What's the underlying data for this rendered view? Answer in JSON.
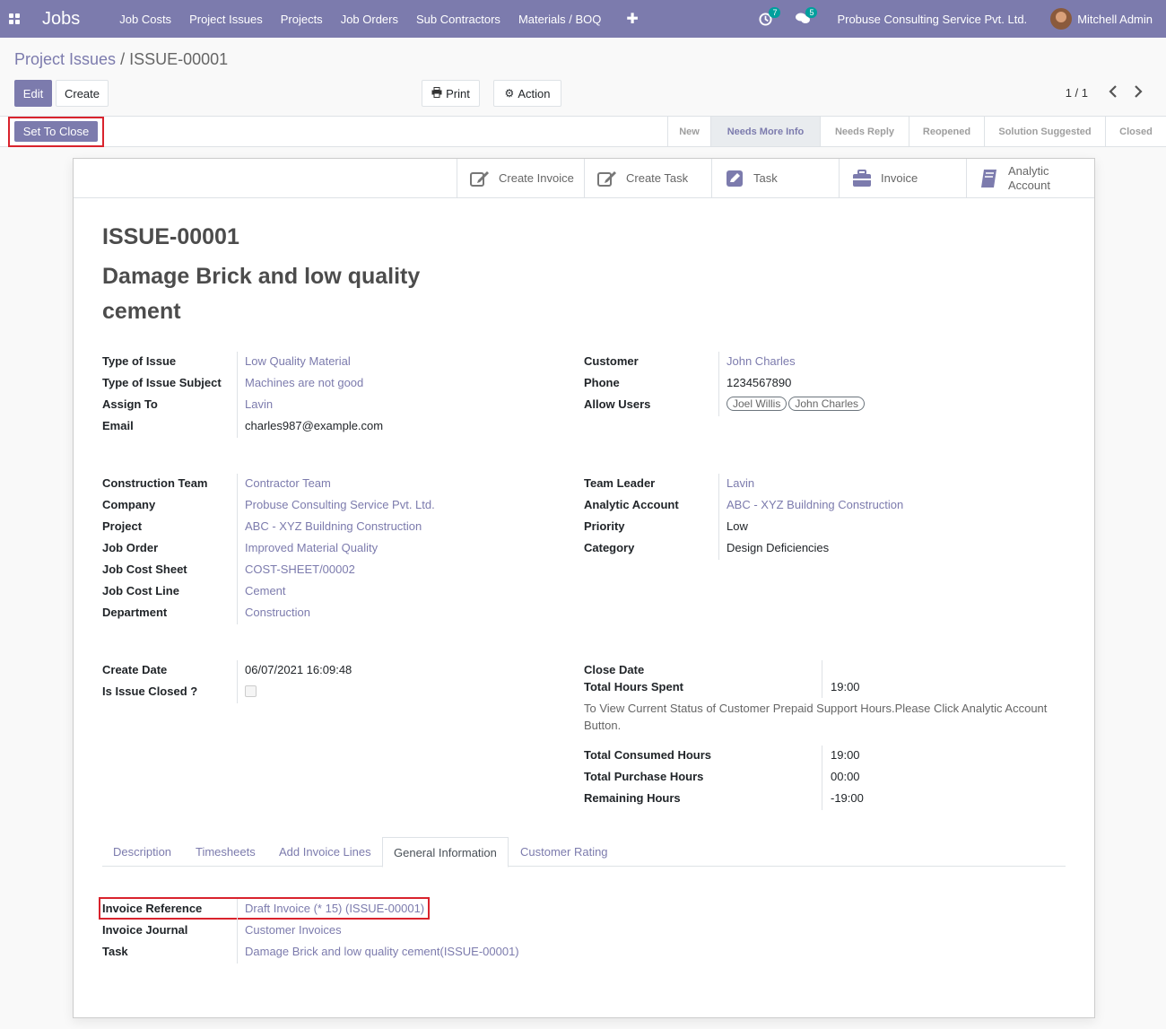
{
  "navbar": {
    "brand": "Jobs",
    "menu": [
      "Job Costs",
      "Project Issues",
      "Projects",
      "Job Orders",
      "Sub Contractors",
      "Materials / BOQ"
    ],
    "activity_count": "7",
    "message_count": "5",
    "company": "Probuse Consulting Service Pvt. Ltd.",
    "user": "Mitchell Admin"
  },
  "breadcrumb": {
    "parent": "Project Issues",
    "separator": "/",
    "current": "ISSUE-00001"
  },
  "buttons": {
    "edit": "Edit",
    "create": "Create",
    "print": "Print",
    "action": "Action",
    "set_to_close": "Set To Close"
  },
  "pager": "1 / 1",
  "stages": [
    "New",
    "Needs More Info",
    "Needs Reply",
    "Reopened",
    "Solution Suggested",
    "Closed"
  ],
  "active_stage": "Needs More Info",
  "smart_buttons": {
    "create_invoice": "Create Invoice",
    "create_task": "Create Task",
    "task": "Task",
    "invoice": "Invoice",
    "analytic_line1": "Analytic",
    "analytic_line2": "Account"
  },
  "record": {
    "reference": "ISSUE-00001",
    "title": "Damage Brick and low quality cement"
  },
  "group1_left": {
    "type_of_issue_label": "Type of Issue",
    "type_of_issue": "Low Quality Material",
    "subject_label": "Type of Issue Subject",
    "subject": "Machines are not good",
    "assign_label": "Assign To",
    "assign": "Lavin",
    "email_label": "Email",
    "email": "charles987@example.com"
  },
  "group1_right": {
    "customer_label": "Customer",
    "customer": "John Charles",
    "phone_label": "Phone",
    "phone": "1234567890",
    "allow_label": "Allow Users",
    "allow_user_1": "Joel Willis",
    "allow_user_2": "John Charles"
  },
  "group2_left": {
    "team_label": "Construction Team",
    "team": "Contractor Team",
    "company_label": "Company",
    "company": "Probuse Consulting Service Pvt. Ltd.",
    "project_label": "Project",
    "project": "ABC - XYZ Buildning Construction",
    "job_order_label": "Job Order",
    "job_order": "Improved Material Quality",
    "cost_sheet_label": "Job Cost Sheet",
    "cost_sheet": "COST-SHEET/00002",
    "cost_line_label": "Job Cost Line",
    "cost_line": "Cement",
    "department_label": "Department",
    "department": "Construction"
  },
  "group2_right": {
    "leader_label": "Team Leader",
    "leader": "Lavin",
    "analytic_label": "Analytic Account",
    "analytic": "ABC - XYZ Buildning Construction",
    "priority_label": "Priority",
    "priority": "Low",
    "category_label": "Category",
    "category": "Design Deficiencies"
  },
  "group3_left": {
    "create_date_label": "Create Date",
    "create_date": "06/07/2021 16:09:48",
    "closed_label": "Is Issue Closed ?"
  },
  "group3_right": {
    "close_date_label": "Close Date",
    "hours_spent_label": "Total Hours Spent",
    "hours_spent": "19:00",
    "note": "To View Current Status of Customer Prepaid Support Hours.Please Click Analytic Account Button.",
    "consumed_label": "Total Consumed Hours",
    "consumed": "19:00",
    "purchase_label": "Total Purchase Hours",
    "purchase": "00:00",
    "remaining_label": "Remaining Hours",
    "remaining": "-19:00"
  },
  "tabs": [
    "Description",
    "Timesheets",
    "Add Invoice Lines",
    "General Information",
    "Customer Rating"
  ],
  "general_info": {
    "invoice_ref_label": "Invoice Reference",
    "invoice_ref": "Draft Invoice (* 15) (ISSUE-00001)",
    "journal_label": "Invoice Journal",
    "journal": "Customer Invoices",
    "task_label": "Task",
    "task": "Damage Brick and low quality cement(ISSUE-00001)"
  },
  "colors": {
    "brand": "#7c7bad",
    "highlight": "#d9232d"
  }
}
